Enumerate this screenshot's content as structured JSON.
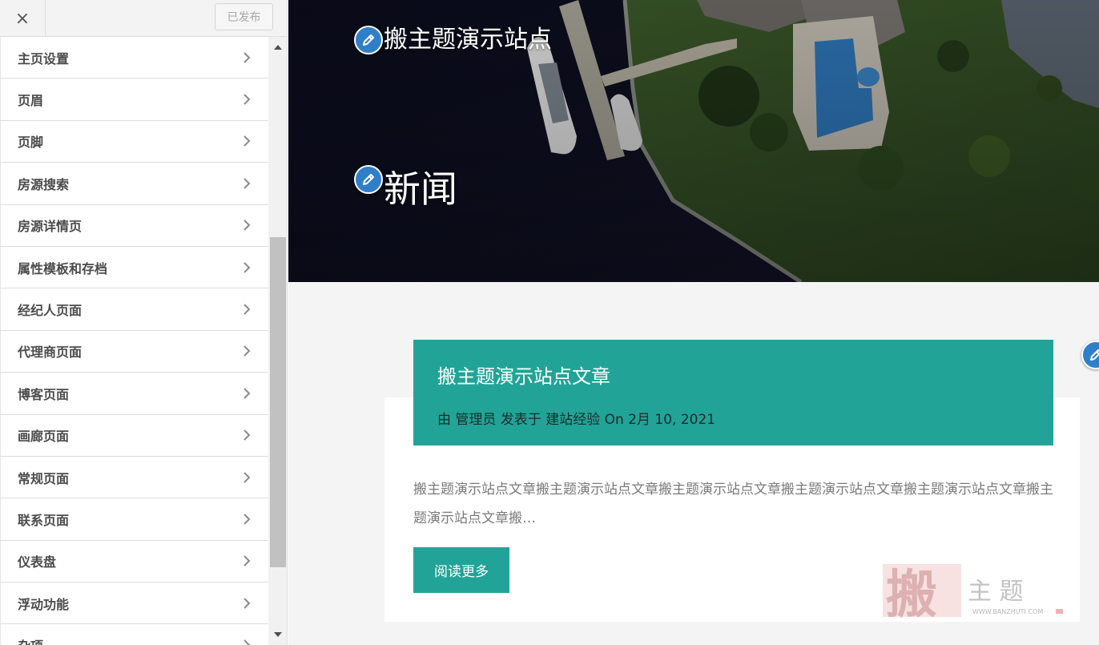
{
  "panel": {
    "close_label": "×",
    "publish_status": "已发布",
    "items": [
      {
        "label": "主页设置"
      },
      {
        "label": "页眉"
      },
      {
        "label": "页脚"
      },
      {
        "label": "房源搜索"
      },
      {
        "label": "房源详情页"
      },
      {
        "label": "属性模板和存档"
      },
      {
        "label": "经纪人页面"
      },
      {
        "label": "代理商页面"
      },
      {
        "label": "博客页面"
      },
      {
        "label": "画廊页面"
      },
      {
        "label": "常规页面"
      },
      {
        "label": "联系页面"
      },
      {
        "label": "仪表盘"
      },
      {
        "label": "浮动功能"
      },
      {
        "label": "杂项"
      }
    ]
  },
  "preview": {
    "site_title": "搬主题演示站点",
    "page_heading": "新闻",
    "post": {
      "title": "搬主题演示站点文章",
      "meta": "由 管理员 发表于 建站经验 On 2月 10, 2021",
      "excerpt": "搬主题演示站点文章搬主题演示站点文章搬主题演示站点文章搬主题演示站点文章搬主题演示站点文章搬主题演示站点文章搬…",
      "read_more": "阅读更多"
    },
    "watermark": {
      "glyph": "搬",
      "text": "主 题",
      "url": "WWW.BANZHUTI.COM"
    }
  },
  "colors": {
    "accent": "#21a497",
    "edit_pin": "#2f7fc8",
    "hero_water": "#0c0d1f"
  },
  "icons": [
    "close-icon",
    "chevron-right-icon",
    "pencil-icon",
    "scroll-up-arrow-icon",
    "scroll-down-arrow-icon"
  ]
}
